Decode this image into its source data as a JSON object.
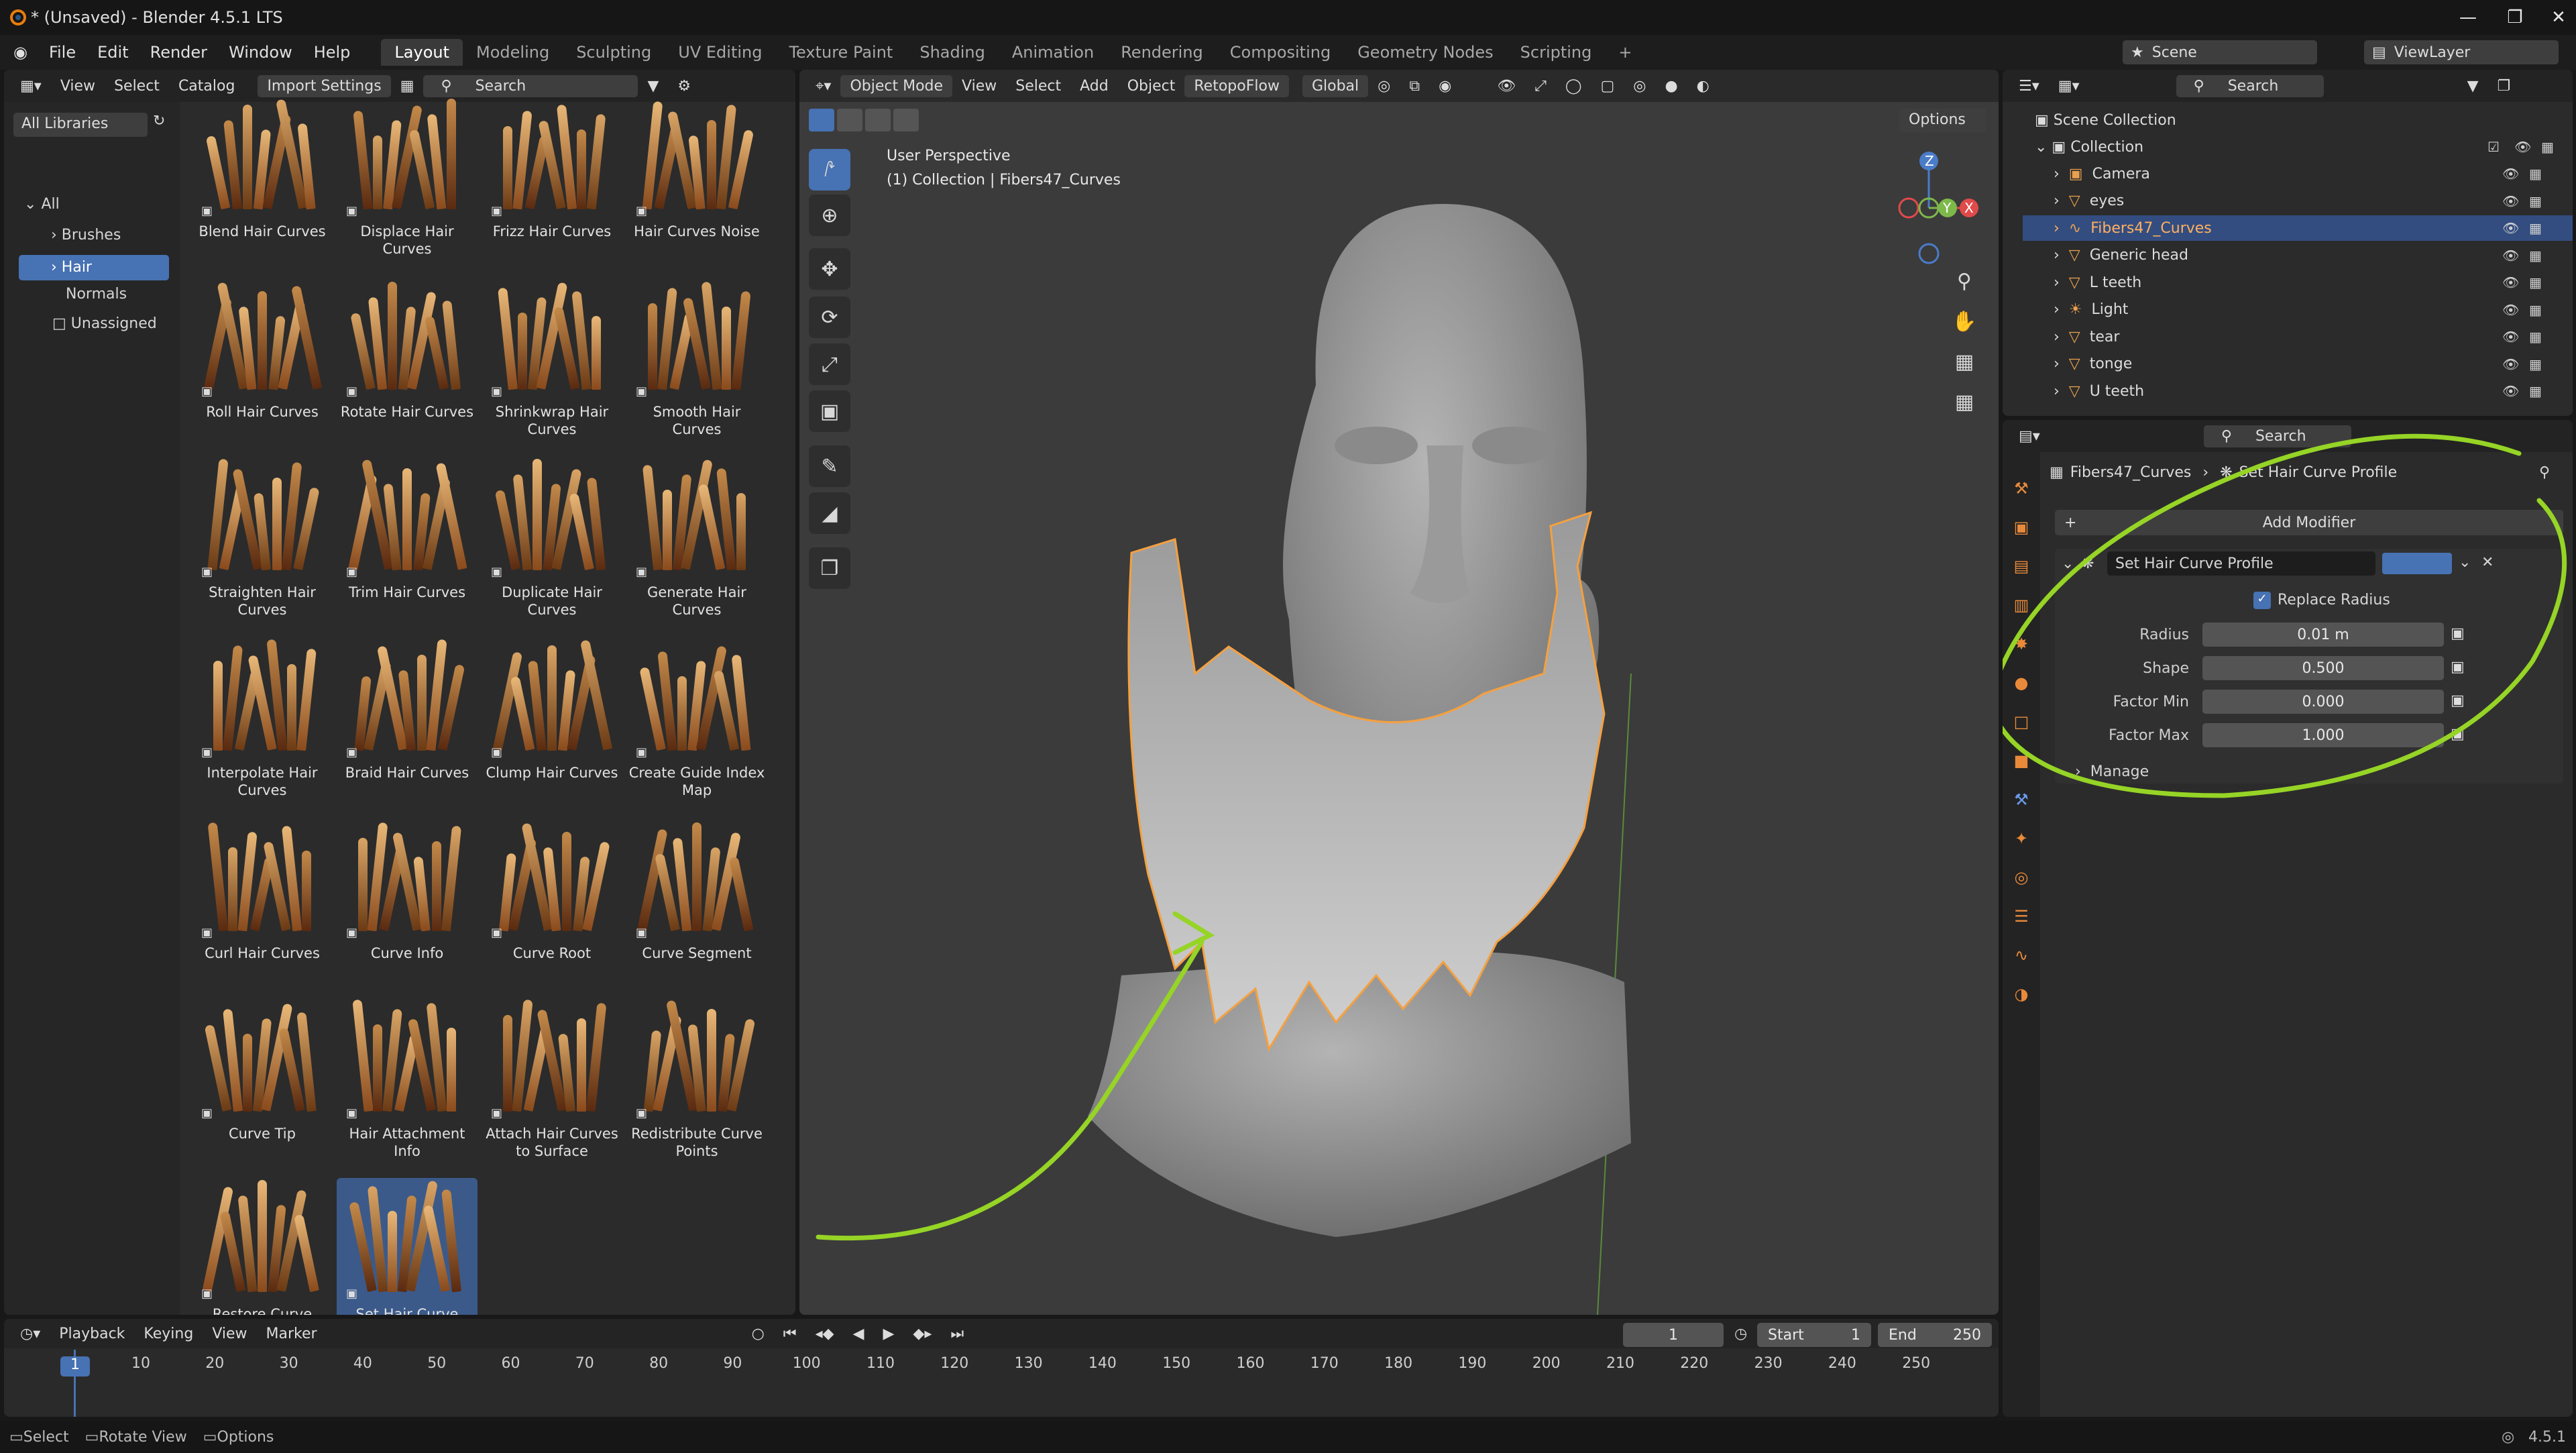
{
  "window": {
    "title": "* (Unsaved) - Blender 4.5.1 LTS"
  },
  "menu": [
    "File",
    "Edit",
    "Render",
    "Window",
    "Help"
  ],
  "workspaces": [
    "Layout",
    "Modeling",
    "Sculpting",
    "UV Editing",
    "Texture Paint",
    "Shading",
    "Animation",
    "Rendering",
    "Compositing",
    "Geometry Nodes",
    "Scripting"
  ],
  "active_workspace": "Layout",
  "scene": {
    "name": "Scene",
    "view_layer": "ViewLayer"
  },
  "asset_browser": {
    "menus": [
      "View",
      "Select",
      "Catalog"
    ],
    "import_settings": "Import Settings",
    "search_placeholder": "Search",
    "library": "All Libraries",
    "catalogs": [
      {
        "label": "All"
      },
      {
        "label": "Brushes"
      },
      {
        "label": "Hair"
      },
      {
        "label": "Normals"
      },
      {
        "label": "Unassigned"
      }
    ],
    "active_catalog": "Hair",
    "assets": [
      "Blend Hair Curves",
      "Displace Hair Curves",
      "Frizz Hair Curves",
      "Hair Curves Noise",
      "Roll Hair Curves",
      "Rotate Hair Curves",
      "Shrinkwrap Hair Curves",
      "Smooth Hair Curves",
      "Straighten Hair Curves",
      "Trim Hair Curves",
      "Duplicate Hair Curves",
      "Generate Hair Curves",
      "Interpolate Hair Curves",
      "Braid Hair Curves",
      "Clump Hair Curves",
      "Create Guide Index Map",
      "Curl Hair Curves",
      "Curve Info",
      "Curve Root",
      "Curve Segment",
      "Curve Tip",
      "Hair Attachment Info",
      "Attach Hair Curves to Surface",
      "Redistribute Curve Points",
      "Restore Curve Segment Length",
      "Set Hair Curve Profile"
    ],
    "selected_asset": "Set Hair Curve Profile"
  },
  "viewport": {
    "mode": "Object Mode",
    "menus": [
      "View",
      "Select",
      "Add",
      "Object"
    ],
    "addon": "RetopoFlow",
    "orientation": "Global",
    "options": "Options",
    "perspective": "User Perspective",
    "collection_info": "(1) Collection | Fibers47_Curves",
    "gizmo_axes": [
      "Z",
      "X",
      "Y"
    ]
  },
  "outliner": {
    "search_placeholder": "Search",
    "root": "Scene Collection",
    "collection": "Collection",
    "items": [
      {
        "name": "Camera"
      },
      {
        "name": "eyes"
      },
      {
        "name": "Fibers47_Curves"
      },
      {
        "name": "Generic head"
      },
      {
        "name": "L teeth"
      },
      {
        "name": "Light"
      },
      {
        "name": "tear"
      },
      {
        "name": "tonge"
      },
      {
        "name": "U teeth"
      }
    ],
    "selected": "Fibers47_Curves"
  },
  "properties": {
    "search_placeholder": "Search",
    "breadcrumb_object": "Fibers47_Curves",
    "breadcrumb_modifier": "Set Hair Curve Profile",
    "add_modifier": "Add Modifier",
    "modifier_name": "Set Hair Curve Profile",
    "replace_radius": "Replace Radius",
    "replace_radius_checked": true,
    "fields": [
      {
        "label": "Radius",
        "value": "0.01 m"
      },
      {
        "label": "Shape",
        "value": "0.500"
      },
      {
        "label": "Factor Min",
        "value": "0.000"
      },
      {
        "label": "Factor Max",
        "value": "1.000"
      }
    ],
    "manage": "Manage"
  },
  "timeline": {
    "menus": [
      "Playback",
      "Keying",
      "View",
      "Marker"
    ],
    "current_frame": "1",
    "start_label": "Start",
    "start": "1",
    "end_label": "End",
    "end": "250",
    "ticks": [
      "1",
      "10",
      "20",
      "30",
      "40",
      "50",
      "60",
      "70",
      "80",
      "90",
      "100",
      "110",
      "120",
      "130",
      "140",
      "150",
      "160",
      "170",
      "180",
      "190",
      "200",
      "210",
      "220",
      "230",
      "240",
      "250"
    ]
  },
  "statusbar": {
    "items": [
      "Select",
      "Rotate View",
      "Options"
    ],
    "version": "4.5.1"
  },
  "colors": {
    "accent": "#4772b3",
    "selection_orange": "#f5a040",
    "annotation_green": "#96d426"
  }
}
